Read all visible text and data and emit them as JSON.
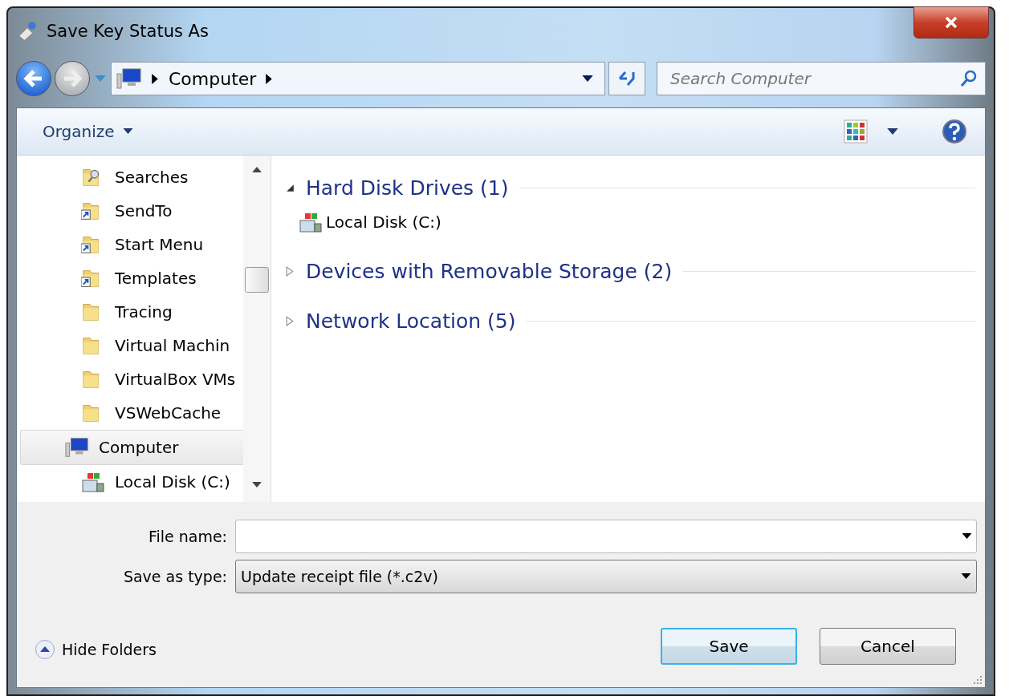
{
  "window": {
    "title": "Save Key Status As"
  },
  "address_bar": {
    "crumbs": [
      "Computer"
    ]
  },
  "search": {
    "placeholder": "Search Computer"
  },
  "toolbar": {
    "organize": "Organize"
  },
  "sidebar": {
    "partial_children": [
      {
        "label": "Searches",
        "kind": "search-folder",
        "selected": false
      },
      {
        "label": "SendTo",
        "kind": "shortcut-folder",
        "selected": false
      },
      {
        "label": "Start Menu",
        "kind": "shortcut-folder",
        "selected": false
      },
      {
        "label": "Templates",
        "kind": "shortcut-folder",
        "selected": false
      },
      {
        "label": "Tracing",
        "kind": "folder",
        "selected": false
      },
      {
        "label": "Virtual Machin",
        "kind": "folder",
        "selected": false
      },
      {
        "label": "VirtualBox VMs",
        "kind": "folder",
        "selected": false
      },
      {
        "label": "VSWebCache",
        "kind": "folder",
        "selected": false
      }
    ],
    "items": [
      {
        "label": "Computer",
        "kind": "computer",
        "selected": true,
        "children": [
          {
            "label": "Local Disk (C:)",
            "kind": "drive",
            "selected": false
          }
        ]
      }
    ]
  },
  "groups": [
    {
      "title": "Hard Disk Drives (1)",
      "expanded": true,
      "items": [
        {
          "label": "Local Disk (C:)"
        }
      ]
    },
    {
      "title": "Devices with Removable Storage (2)",
      "expanded": false
    },
    {
      "title": "Network Location (5)",
      "expanded": false
    }
  ],
  "form": {
    "file_name_label": "File name:",
    "type_label": "Save as type:",
    "type_value": "Update receipt file (*.c2v)"
  },
  "hide_folders": "Hide Folders",
  "buttons": [
    {
      "label": "Save",
      "default": true
    },
    {
      "label": "Cancel",
      "default": false
    }
  ]
}
